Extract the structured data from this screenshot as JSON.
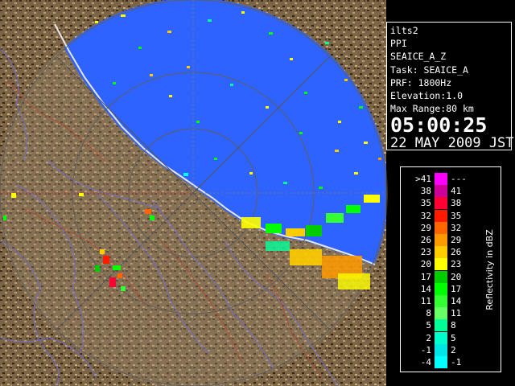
{
  "info": {
    "radar": "ilts2",
    "mode": "PPI",
    "product": "SEAICE_A_Z",
    "task": "Task: SEAICE_A",
    "prf": "PRF: 1800Hz",
    "elevation": "Elevation:1.0",
    "max_range": "Max Range:80 km",
    "time": "05:00:25",
    "date": "22 MAY 2009 JST"
  },
  "legend": {
    "unit_label": "Reflectivity in dBZ",
    "rows": [
      {
        "lo": ">41",
        "hi": "---",
        "color": "#ff00ff"
      },
      {
        "lo": "38",
        "hi": "41",
        "color": "#cc0099"
      },
      {
        "lo": "35",
        "hi": "38",
        "color": "#ff0033"
      },
      {
        "lo": "32",
        "hi": "35",
        "color": "#ff1a00"
      },
      {
        "lo": "29",
        "hi": "32",
        "color": "#ff6600"
      },
      {
        "lo": "26",
        "hi": "29",
        "color": "#ff9900"
      },
      {
        "lo": "23",
        "hi": "26",
        "color": "#ffcc00"
      },
      {
        "lo": "20",
        "hi": "23",
        "color": "#ffff00"
      },
      {
        "lo": "17",
        "hi": "20",
        "color": "#00cc00"
      },
      {
        "lo": "14",
        "hi": "17",
        "color": "#00ff00"
      },
      {
        "lo": "11",
        "hi": "14",
        "color": "#33ff33"
      },
      {
        "lo": "8",
        "hi": "11",
        "color": "#66ff66"
      },
      {
        "lo": "5",
        "hi": "8",
        "color": "#00ff99"
      },
      {
        "lo": "2",
        "hi": "5",
        "color": "#00ffcc"
      },
      {
        "lo": "-1",
        "hi": "2",
        "color": "#00e6e6"
      },
      {
        "lo": "-4",
        "hi": "-1",
        "color": "#00ffff"
      }
    ]
  },
  "colors": {
    "sea_echo": "#2f63ff",
    "land": "#8b7453",
    "range_ring": "#6b6b6b"
  }
}
